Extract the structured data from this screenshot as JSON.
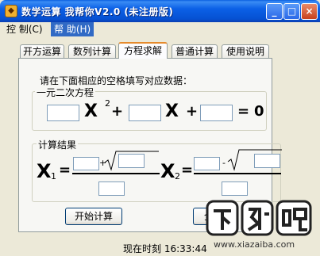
{
  "window": {
    "title": "数学运算 我帮你V2.0 (未注册版)"
  },
  "menu": [
    {
      "label": "控 制(C)"
    },
    {
      "label": "帮 助(H)"
    }
  ],
  "tabs": [
    {
      "label": "开方运算"
    },
    {
      "label": "数列计算"
    },
    {
      "label": "方程求解"
    },
    {
      "label": "普通计算"
    },
    {
      "label": "使用说明"
    }
  ],
  "panel": {
    "instruction": "请在下面相应的空格填写对应数据：",
    "equation_group": {
      "title": "一元二次方程",
      "x_symbol": "X",
      "exponent": "2",
      "plus": "+",
      "equals": "=",
      "zero": "0"
    },
    "result_group": {
      "title": "计算结果",
      "x1_symbol": "X",
      "x1_sub": "1",
      "x2_symbol": "X",
      "x2_sub": "2",
      "eq": "=",
      "plus_small": "+",
      "minus_small": "-"
    },
    "buttons": {
      "start": "开始计算",
      "clear": "全"
    }
  },
  "status": {
    "time": "现在时刻 16:33:44"
  },
  "watermark": {
    "brand": "下载吧",
    "url": "www.xiazaiba.com"
  }
}
